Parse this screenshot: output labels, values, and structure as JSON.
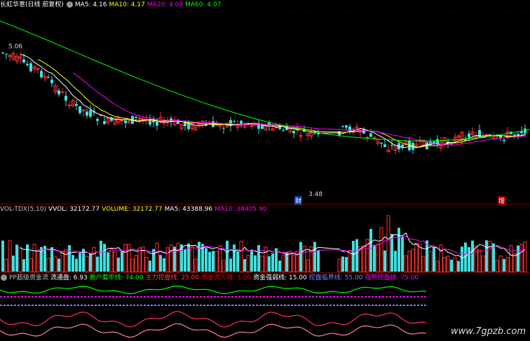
{
  "main_panel": {
    "title": "长虹华意(日线 前复权)",
    "ma_labels": [
      {
        "text": "MA5: 4.16",
        "color": "#ffffff"
      },
      {
        "text": "MA10: 4.17",
        "color": "#ffff00"
      },
      {
        "text": "MA20: 4.09",
        "color": "#ff00ff"
      },
      {
        "text": "MA60: 4.07",
        "color": "#00ff00"
      }
    ],
    "price_high_label": "5.06",
    "price_low_label": "3.48",
    "bottom_markers": [
      "财",
      "增"
    ]
  },
  "volume_panel": {
    "header": [
      {
        "text": "VOL-TDX(5,10)",
        "color": "#c0c0c0"
      },
      {
        "text": "VVOL: 32172.77",
        "color": "#ffffff"
      },
      {
        "text": "VOLUME: 32172.77",
        "color": "#ffff00"
      },
      {
        "text": "MA5: 43388.96",
        "color": "#ffffff"
      },
      {
        "text": "MA10: 38405.90",
        "color": "#ff00ff"
      }
    ]
  },
  "pp_panel": {
    "header": [
      {
        "text": "PP超级资金流",
        "color": "#c0c0c0"
      },
      {
        "text": "流通盘: 6.93",
        "color": "#ffffff"
      },
      {
        "text": "散户套牢线: 74.00",
        "color": "#00ff00"
      },
      {
        "text": "主力控盘线: 25.00",
        "color": "#ff4040"
      },
      {
        "text": "资金流入线: 3.00",
        "color": "#ff0000"
      },
      {
        "text": "资金强弱线: 15.00",
        "color": "#ffffff"
      },
      {
        "text": "控盘临界线: 55.00",
        "color": "#8080ff"
      },
      {
        "text": "强势控盘线: 75.00",
        "color": "#ff00ff"
      }
    ]
  },
  "watermark": "www.7gpzb.com",
  "colors": {
    "up": "#ff3030",
    "down": "#40e0e0",
    "bg": "#000000",
    "separator": "#7a0000"
  }
}
